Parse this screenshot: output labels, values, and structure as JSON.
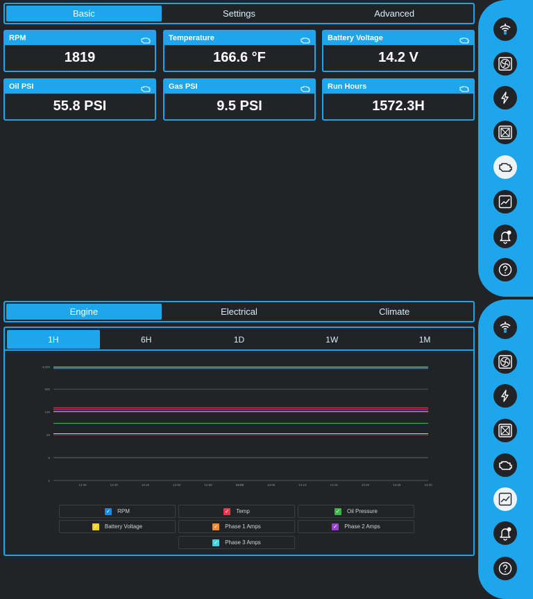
{
  "top_tabs": [
    "Basic",
    "Settings",
    "Advanced"
  ],
  "top_tabs_active": 0,
  "cards": [
    {
      "label": "RPM",
      "value": "1819"
    },
    {
      "label": "Temperature",
      "value": "166.6 °F"
    },
    {
      "label": "Battery Voltage",
      "value": "14.2 V"
    },
    {
      "label": "Oil PSI",
      "value": "55.8 PSI"
    },
    {
      "label": "Gas PSI",
      "value": "9.5 PSI"
    },
    {
      "label": "Run Hours",
      "value": "1572.3H"
    }
  ],
  "card_icon": "engine-icon",
  "section_tabs": [
    "Engine",
    "Electrical",
    "Climate"
  ],
  "section_tabs_active": 0,
  "ranges": [
    "1H",
    "6H",
    "1D",
    "1W",
    "1M"
  ],
  "ranges_active": 0,
  "sidebar_icons": [
    "signal-icon",
    "fan-icon",
    "lightning-icon",
    "radiator-icon",
    "engine-icon",
    "chart-icon",
    "bell-icon",
    "help-icon"
  ],
  "colors": {
    "accent": "#1ea6ec",
    "background": "#212326"
  },
  "chart_data": {
    "type": "line",
    "y_scale": "log",
    "y_ticks": [
      "3,000",
      "625",
      "125",
      "25",
      "5",
      "1"
    ],
    "x_ticks": [
      "12:35",
      "12:40",
      "12:45",
      "12:50",
      "12:55",
      "13:00",
      "13:05",
      "13:10",
      "13:15",
      "13:20",
      "13:25",
      "13:30"
    ],
    "grid": true,
    "series": [
      {
        "name": "RPM",
        "color": "#1e88e5",
        "values": [
          2650,
          2650,
          2650,
          2650,
          2650,
          2650,
          2650,
          2650,
          2650,
          2650,
          2650,
          2650
        ]
      },
      {
        "name": "Temp",
        "color": "#e53950",
        "values": [
          167,
          167,
          167,
          167,
          167,
          167,
          167,
          167,
          167,
          167,
          167,
          167
        ]
      },
      {
        "name": "Oil Pressure",
        "color": "#3bb54a",
        "values": [
          56,
          56,
          56,
          56,
          56,
          56,
          56,
          56,
          56,
          56,
          56,
          56
        ]
      },
      {
        "name": "Battery Voltage",
        "color": "#f2d21c",
        "values": [
          27,
          27,
          27,
          27,
          27,
          27,
          27,
          27,
          27,
          27,
          27,
          27
        ]
      },
      {
        "name": "Phase 1 Amps",
        "color": "#f08a2a",
        "values": [
          130,
          130,
          130,
          130,
          130,
          130,
          130,
          130,
          130,
          130,
          130,
          130
        ]
      },
      {
        "name": "Phase 2 Amps",
        "color": "#9b3fd6",
        "values": [
          150,
          150,
          150,
          150,
          150,
          150,
          150,
          150,
          150,
          150,
          150,
          150
        ]
      },
      {
        "name": "Phase 3 Amps",
        "color": "#3fd3e0",
        "values": [
          2900,
          2900,
          2900,
          2900,
          2900,
          2900,
          2900,
          2900,
          2900,
          2900,
          2900,
          2900
        ]
      }
    ]
  }
}
